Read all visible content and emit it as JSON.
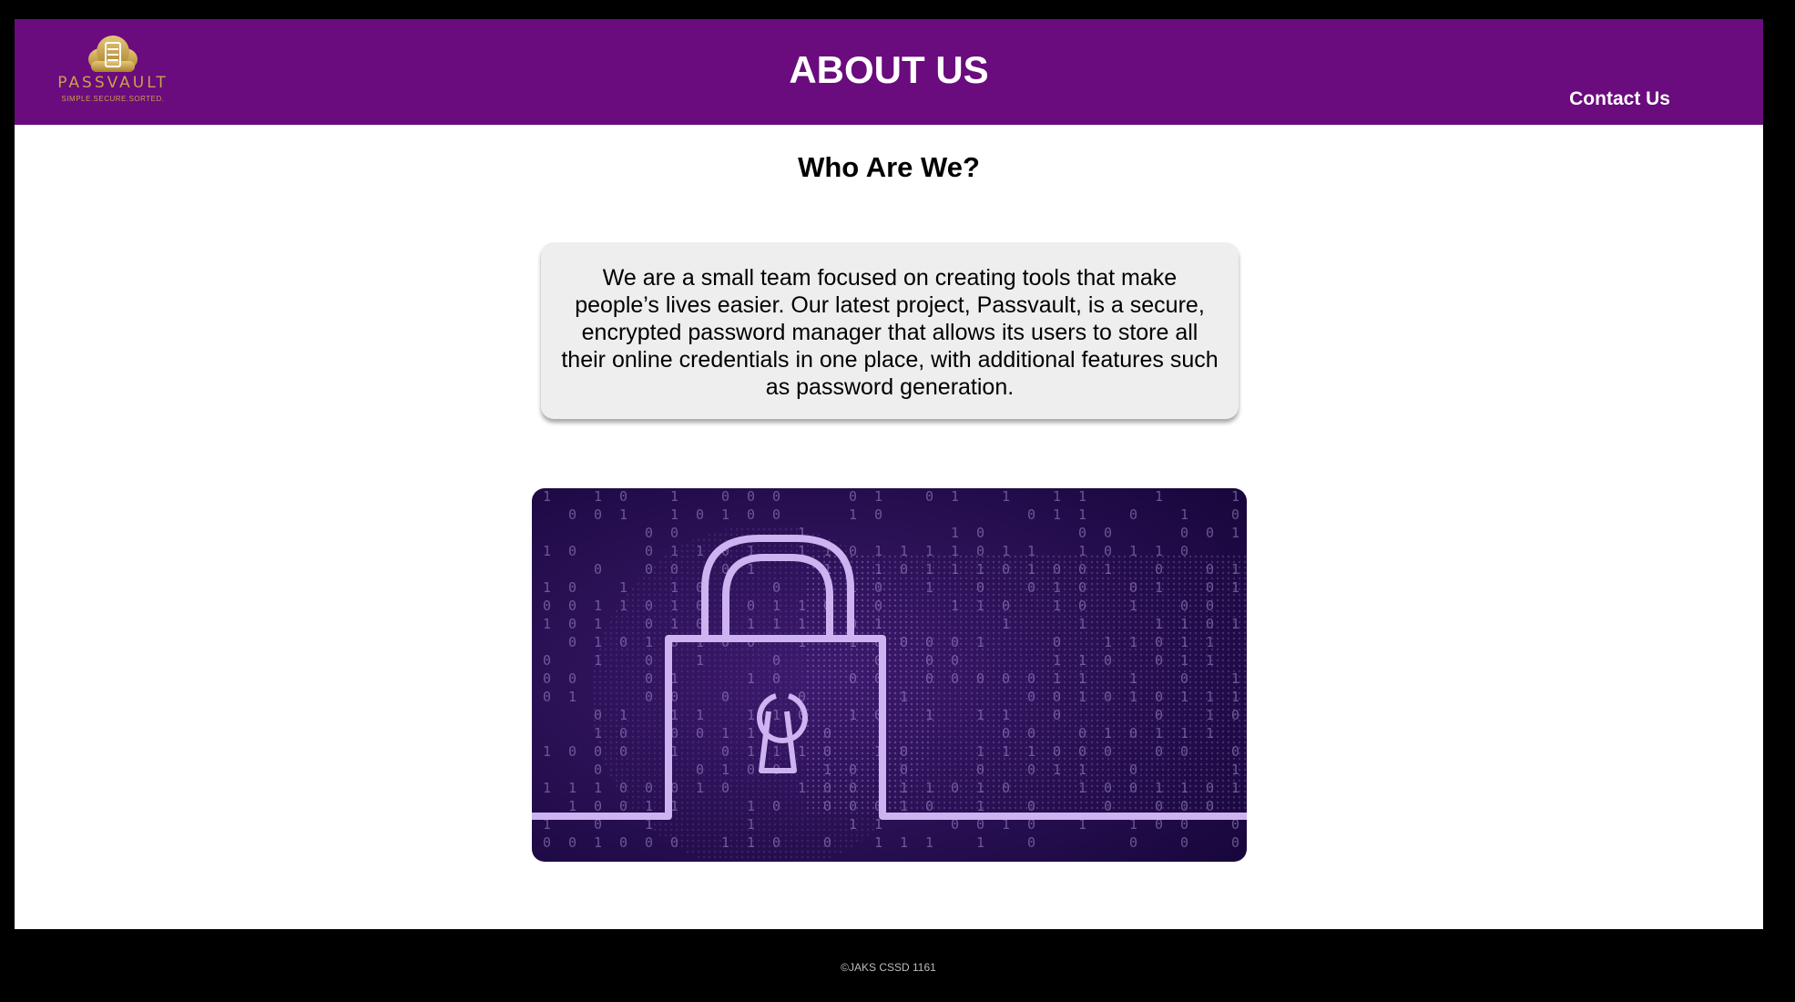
{
  "header": {
    "logo": {
      "name": "PASSVAULT",
      "tagline": "SIMPLE.SECURE.SORTED.",
      "icon": "cloud-server-icon"
    },
    "title": "ABOUT US",
    "nav": {
      "contact_label": "Contact Us"
    }
  },
  "main": {
    "heading": "Who Are We?",
    "about_text": "We are a small team focused on creating tools that make people’s lives easier. Our latest project, Passvault, is a secure, encrypted password manager that allows its users to store all their online credentials in one place, with additional features such as password generation.",
    "hero_image": {
      "icon": "padlock-binary-icon"
    }
  },
  "footer": {
    "copyright": "©JAKS CSSD 1161"
  },
  "colors": {
    "header_bg": "#6a0b7e",
    "page_bg": "#000000",
    "content_bg": "#ffffff",
    "card_bg": "#eeeeee",
    "logo_gold": "#c9a24a",
    "hero_bg": "#230a45",
    "hero_accent": "#cdb3f0"
  }
}
